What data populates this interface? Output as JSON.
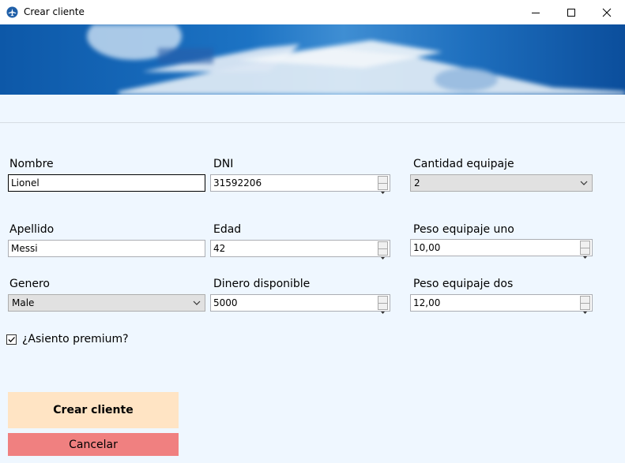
{
  "window": {
    "title": "Crear cliente"
  },
  "form": {
    "nombre": {
      "label": "Nombre",
      "value": "Lionel"
    },
    "dni": {
      "label": "DNI",
      "value": "31592206"
    },
    "cantidad_equipaje": {
      "label": "Cantidad equipaje",
      "value": "2"
    },
    "apellido": {
      "label": "Apellido",
      "value": "Messi"
    },
    "edad": {
      "label": "Edad",
      "value": "42"
    },
    "peso_uno": {
      "label": "Peso equipaje uno",
      "value": "10,00"
    },
    "genero": {
      "label": "Genero",
      "value": "Male"
    },
    "dinero": {
      "label": "Dinero disponible",
      "value": "5000"
    },
    "peso_dos": {
      "label": "Peso equipaje dos",
      "value": "12,00"
    },
    "premium": {
      "label": "¿Asiento premium?",
      "checked": true
    }
  },
  "buttons": {
    "create": "Crear cliente",
    "cancel": "Cancelar"
  },
  "colors": {
    "background": "#eff7ff",
    "create_button": "#ffe4c4",
    "cancel_button": "#f08080"
  }
}
